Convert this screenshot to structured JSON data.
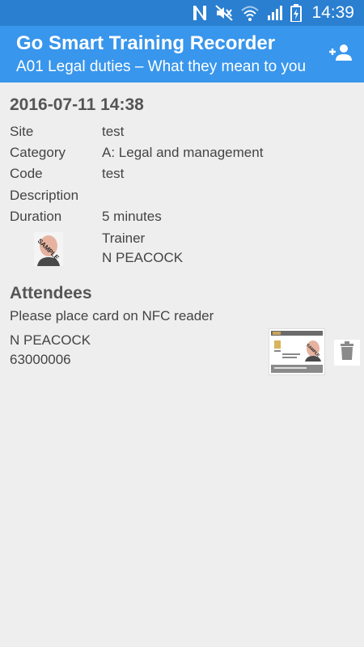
{
  "status_bar": {
    "time": "14:39",
    "icons": [
      "nfc-icon",
      "mute-icon",
      "wifi-icon",
      "signal-icon",
      "battery-icon"
    ]
  },
  "app_bar": {
    "title": "Go Smart Training Recorder",
    "subtitle": "A01 Legal duties – What they mean to you",
    "action_icon": "add-person-icon"
  },
  "session": {
    "datetime": "2016-07-11 14:38",
    "fields": [
      {
        "label": "Site",
        "value": "test"
      },
      {
        "label": "Category",
        "value": "A: Legal and management"
      },
      {
        "label": "Code",
        "value": "test"
      },
      {
        "label": "Description",
        "value": ""
      },
      {
        "label": "Duration",
        "value": "5 minutes"
      }
    ],
    "trainer": {
      "role_label": "Trainer",
      "name": "N PEACOCK",
      "photo_stamp": "SAMPLE"
    }
  },
  "attendees": {
    "title": "Attendees",
    "hint": "Please place card on NFC reader",
    "items": [
      {
        "name": "N PEACOCK",
        "id": "63000006",
        "card_stamp": "SAMPLE",
        "delete_icon": "trash-icon"
      }
    ]
  },
  "colors": {
    "status_bar": "#2a7fd0",
    "app_bar": "#3896ec",
    "background": "#eeeeee"
  }
}
